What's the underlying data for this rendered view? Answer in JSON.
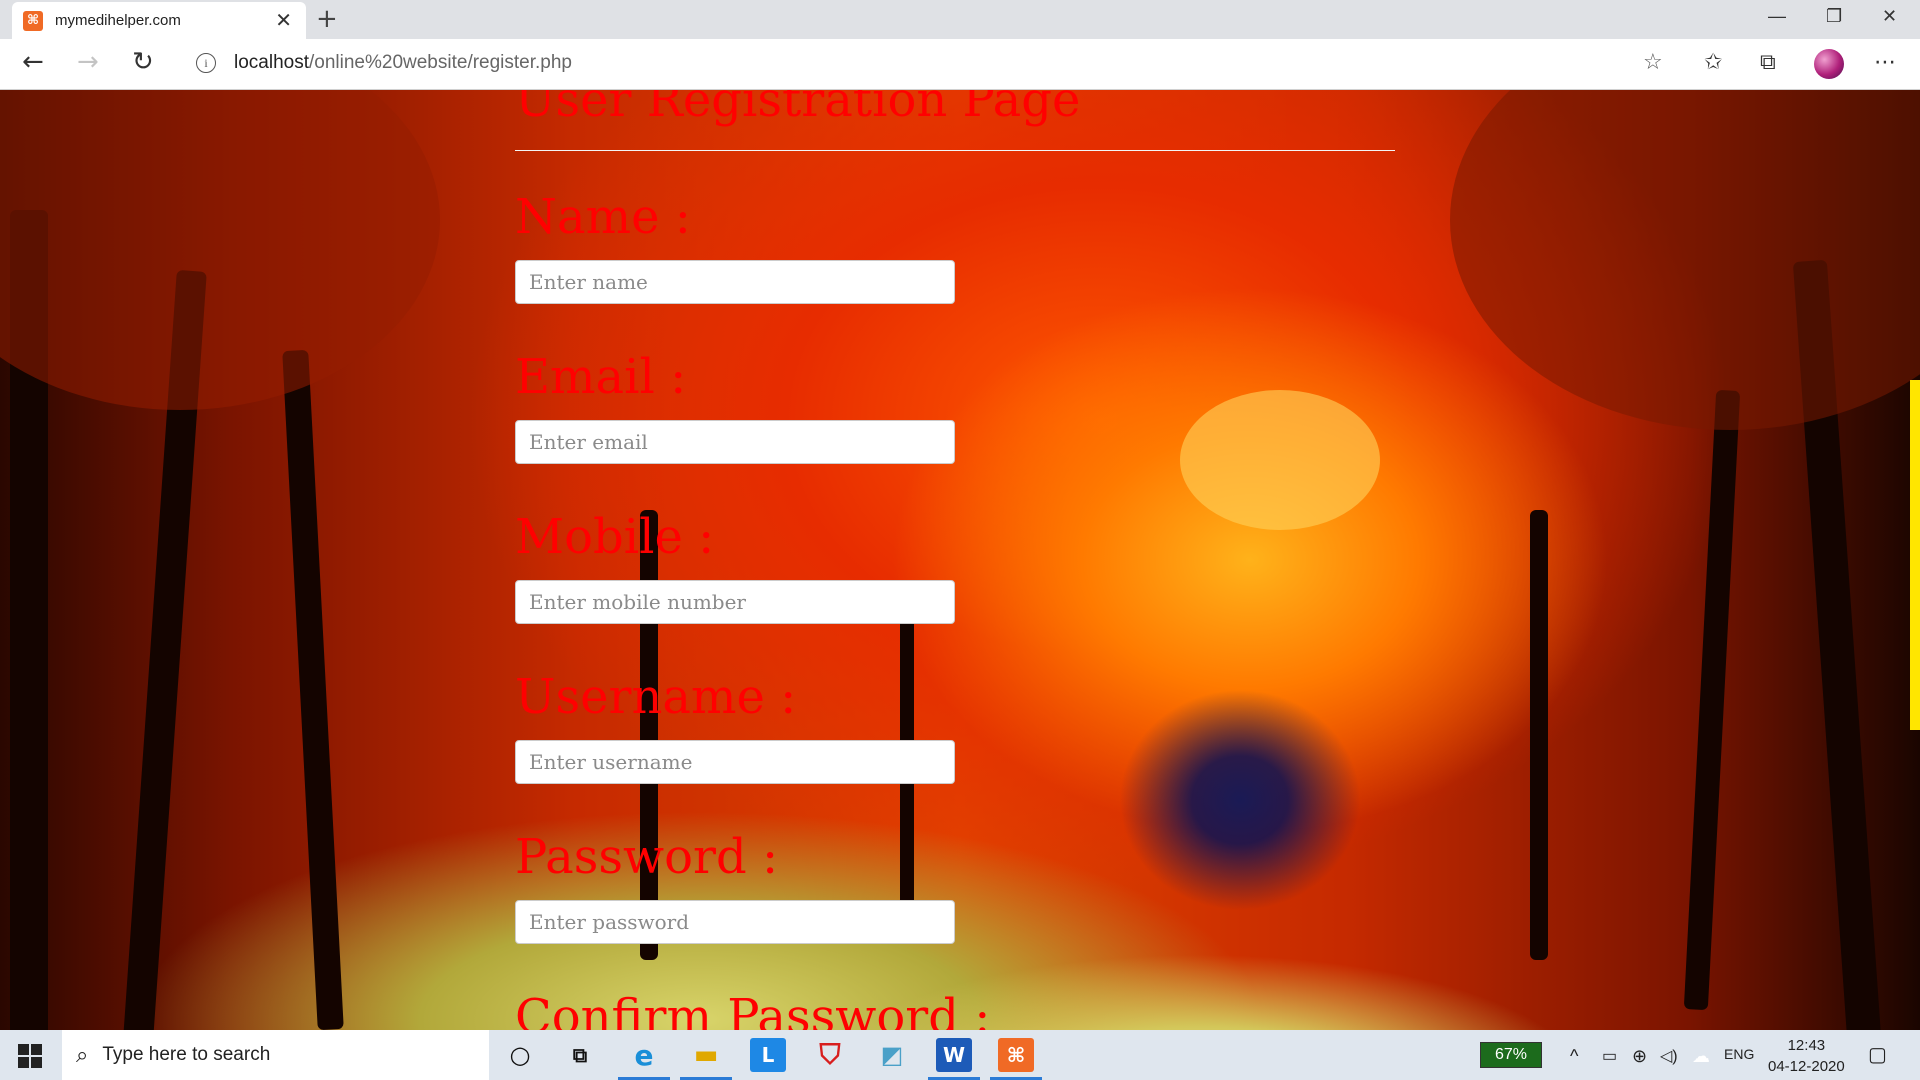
{
  "browser": {
    "tab_title": "mymedihelper.com",
    "favicon_glyph": "⌘",
    "url_host": "localhost",
    "url_path": "/online%20website/register.php"
  },
  "page": {
    "heading": "User Registration Page",
    "fields": [
      {
        "label": "Name :",
        "placeholder": "Enter name"
      },
      {
        "label": "Email :",
        "placeholder": "Enter email"
      },
      {
        "label": "Mobile :",
        "placeholder": "Enter mobile number"
      },
      {
        "label": "Username :",
        "placeholder": "Enter username"
      },
      {
        "label": "Password :",
        "placeholder": "Enter password"
      },
      {
        "label": "Confirm Password :"
      }
    ],
    "text_color": "#ff0000"
  },
  "taskbar": {
    "search_placeholder": "Type here to search",
    "battery_percent": "67%",
    "language": "ENG",
    "time": "12:43",
    "date": "04-12-2020"
  }
}
